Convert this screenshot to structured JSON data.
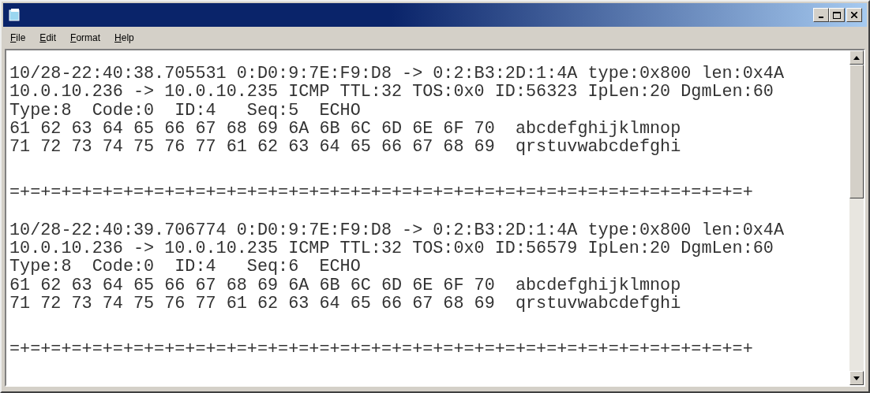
{
  "menu": [
    "File",
    "Edit",
    "Format",
    "Help"
  ],
  "records": [
    {
      "lines": [
        "10/28-22:40:38.705531 0:D0:9:7E:F9:D8 -> 0:2:B3:2D:1:4A type:0x800 len:0x4A",
        "10.0.10.236 -> 10.0.10.235 ICMP TTL:32 TOS:0x0 ID:56323 IpLen:20 DgmLen:60",
        "Type:8  Code:0  ID:4   Seq:5  ECHO",
        "61 62 63 64 65 66 67 68 69 6A 6B 6C 6D 6E 6F 70  abcdefghijklmnop",
        "71 72 73 74 75 76 77 61 62 63 64 65 66 67 68 69  qrstuvwabcdefghi"
      ],
      "separator": "=+=+=+=+=+=+=+=+=+=+=+=+=+=+=+=+=+=+=+=+=+=+=+=+=+=+=+=+=+=+=+=+=+=+=+=+"
    },
    {
      "lines": [
        "10/28-22:40:39.706774 0:D0:9:7E:F9:D8 -> 0:2:B3:2D:1:4A type:0x800 len:0x4A",
        "10.0.10.236 -> 10.0.10.235 ICMP TTL:32 TOS:0x0 ID:56579 IpLen:20 DgmLen:60",
        "Type:8  Code:0  ID:4   Seq:6  ECHO",
        "61 62 63 64 65 66 67 68 69 6A 6B 6C 6D 6E 6F 70  abcdefghijklmnop",
        "71 72 73 74 75 76 77 61 62 63 64 65 66 67 68 69  qrstuvwabcdefghi"
      ],
      "separator": "=+=+=+=+=+=+=+=+=+=+=+=+=+=+=+=+=+=+=+=+=+=+=+=+=+=+=+=+=+=+=+=+=+=+=+=+"
    }
  ]
}
